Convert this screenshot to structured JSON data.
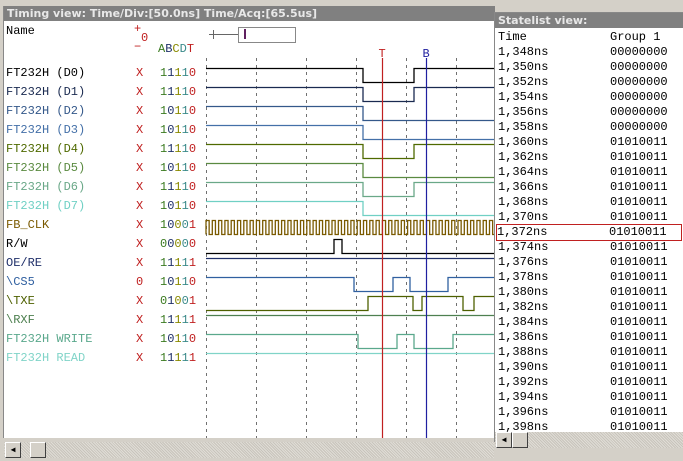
{
  "timing": {
    "title": "Timing view:  Time/Div:[50.0ns] Time/Acq:[65.5us]",
    "name_header": "Name",
    "plus": "+",
    "zero": "0",
    "minus": "−",
    "abcdt": [
      "A",
      "B",
      "C",
      "D",
      "T"
    ],
    "cursor_t": {
      "label": "T",
      "time_ns": 176,
      "color": "#c02020"
    },
    "cursor_b": {
      "label": "B",
      "time_ns": 220,
      "color": "#2020a0"
    },
    "grid_ns": 50,
    "signals": [
      {
        "name": "FT232H (D0)",
        "color": "#000000",
        "flag": "X",
        "vals": "11110",
        "kind": "wave",
        "init": 1,
        "edges": [
          157,
          208
        ]
      },
      {
        "name": "FT232H (D1)",
        "color": "#1a2a50",
        "flag": "X",
        "vals": "11110",
        "kind": "wave",
        "init": 1,
        "edges": [
          157,
          208
        ]
      },
      {
        "name": "FT232H (D2)",
        "color": "#34588a",
        "flag": "X",
        "vals": "10110",
        "kind": "wave",
        "init": 1,
        "edges": [
          157
        ]
      },
      {
        "name": "FT232H (D3)",
        "color": "#4470a8",
        "flag": "X",
        "vals": "10110",
        "kind": "wave",
        "init": 1,
        "edges": [
          157
        ]
      },
      {
        "name": "FT232H (D4)",
        "color": "#4f6a00",
        "flag": "X",
        "vals": "11110",
        "kind": "wave",
        "init": 1,
        "edges": [
          157,
          208
        ]
      },
      {
        "name": "FT232H (D5)",
        "color": "#5a8a40",
        "flag": "X",
        "vals": "10110",
        "kind": "wave",
        "init": 1,
        "edges": [
          157
        ]
      },
      {
        "name": "FT232H (D6)",
        "color": "#6aa888",
        "flag": "X",
        "vals": "11110",
        "kind": "wave",
        "init": 1,
        "edges": [
          157,
          208
        ]
      },
      {
        "name": "FT232H (D7)",
        "color": "#70d0c4",
        "flag": "X",
        "vals": "10110",
        "kind": "wave",
        "init": 1,
        "edges": [
          157
        ]
      },
      {
        "name": "FB_CLK",
        "color": "#7a5a00",
        "flag": "X",
        "vals": "10001",
        "kind": "clock",
        "period_ns": 6.3
      },
      {
        "name": "R/W",
        "color": "#000000",
        "flag": "X",
        "vals": "00000",
        "kind": "wave",
        "init": 0,
        "edges": [
          128,
          136
        ]
      },
      {
        "name": "OE/RE",
        "color": "#20306a",
        "flag": "X",
        "vals": "11111",
        "kind": "wave",
        "init": 1,
        "edges": []
      },
      {
        "name": "\\CS5",
        "color": "#3060a0",
        "flag": "0",
        "vals": "10110",
        "kind": "wave",
        "init": 1,
        "edges": [
          148,
          187,
          204,
          242
        ]
      },
      {
        "name": "\\TXE",
        "color": "#4e6000",
        "flag": "X",
        "vals": "01001",
        "kind": "wave",
        "init": 0,
        "edges": [
          162,
          207,
          216,
          257,
          268
        ]
      },
      {
        "name": "\\RXF",
        "color": "#4e8050",
        "flag": "X",
        "vals": "11111",
        "kind": "wave",
        "init": 1,
        "edges": []
      },
      {
        "name": "FT232H WRITE",
        "color": "#5aa88c",
        "flag": "X",
        "vals": "10110",
        "kind": "wave",
        "init": 1,
        "edges": [
          152,
          191,
          208,
          247
        ]
      },
      {
        "name": "FT232H READ",
        "color": "#80d4c8",
        "flag": "X",
        "vals": "11111",
        "kind": "wave",
        "init": 1,
        "edges": []
      }
    ]
  },
  "statelist": {
    "title": "Statelist view:",
    "col_time": "Time",
    "col_group": "Group 1",
    "selected_index": 12,
    "rows": [
      [
        "1,348ns",
        "00000000"
      ],
      [
        "1,350ns",
        "00000000"
      ],
      [
        "1,352ns",
        "00000000"
      ],
      [
        "1,354ns",
        "00000000"
      ],
      [
        "1,356ns",
        "00000000"
      ],
      [
        "1,358ns",
        "00000000"
      ],
      [
        "1,360ns",
        "01010011"
      ],
      [
        "1,362ns",
        "01010011"
      ],
      [
        "1,364ns",
        "01010011"
      ],
      [
        "1,366ns",
        "01010011"
      ],
      [
        "1,368ns",
        "01010011"
      ],
      [
        "1,370ns",
        "01010011"
      ],
      [
        "1,372ns",
        "01010011"
      ],
      [
        "1,374ns",
        "01010011"
      ],
      [
        "1,376ns",
        "01010011"
      ],
      [
        "1,378ns",
        "01010011"
      ],
      [
        "1,380ns",
        "01010011"
      ],
      [
        "1,382ns",
        "01010011"
      ],
      [
        "1,384ns",
        "01010011"
      ],
      [
        "1,386ns",
        "01010011"
      ],
      [
        "1,388ns",
        "01010011"
      ],
      [
        "1,390ns",
        "01010011"
      ],
      [
        "1,392ns",
        "01010011"
      ],
      [
        "1,394ns",
        "01010011"
      ],
      [
        "1,396ns",
        "01010011"
      ],
      [
        "1,398ns",
        "01010011"
      ]
    ]
  }
}
